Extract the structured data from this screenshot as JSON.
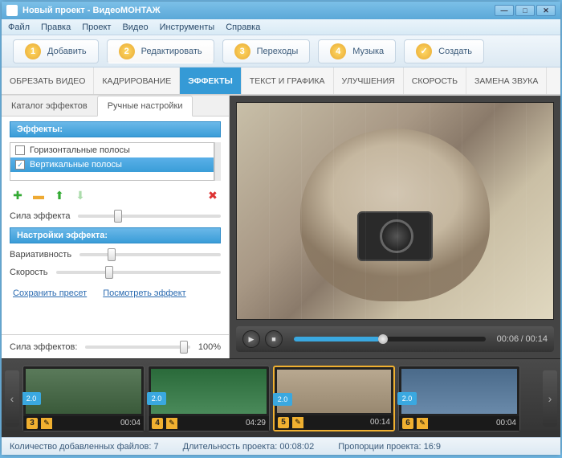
{
  "window": {
    "title": "Новый проект - ВидеоМОНТАЖ"
  },
  "menu": {
    "items": [
      "Файл",
      "Правка",
      "Проект",
      "Видео",
      "Инструменты",
      "Справка"
    ]
  },
  "mainTabs": [
    {
      "num": "1",
      "label": "Добавить"
    },
    {
      "num": "2",
      "label": "Редактировать",
      "active": true
    },
    {
      "num": "3",
      "label": "Переходы"
    },
    {
      "num": "4",
      "label": "Музыка"
    },
    {
      "num": "✓",
      "label": "Создать",
      "check": true
    }
  ],
  "subTabs": [
    "ОБРЕЗАТЬ ВИДЕО",
    "КАДРИРОВАНИЕ",
    "ЭФФЕКТЫ",
    "ТЕКСТ И ГРАФИКА",
    "УЛУЧШЕНИЯ",
    "СКОРОСТЬ",
    "ЗАМЕНА ЗВУКА"
  ],
  "subTabActive": 2,
  "leftPanel": {
    "tabs": [
      "Каталог эффектов",
      "Ручные настройки"
    ],
    "tabActive": 1,
    "effectsHeader": "Эффекты:",
    "effects": [
      {
        "label": "Горизонтальные полосы",
        "checked": false,
        "selected": false
      },
      {
        "label": "Вертикальные полосы",
        "checked": true,
        "selected": true
      }
    ],
    "strengthLabel": "Сила эффекта",
    "settingsHeader": "Настройки эффекта:",
    "variabilityLabel": "Вариативность",
    "speedLabel": "Скорость",
    "savePreset": "Сохранить пресет",
    "viewEffect": "Посмотреть эффект",
    "overallLabel": "Сила эффектов:",
    "overallValue": "100%"
  },
  "player": {
    "current": "00:06",
    "total": "00:14"
  },
  "timeline": {
    "clips": [
      {
        "num": "3",
        "dur": "00:04",
        "trans": "2.0"
      },
      {
        "num": "4",
        "dur": "04:29",
        "trans": "2.0"
      },
      {
        "num": "5",
        "dur": "00:14",
        "trans": "2.0",
        "selected": true,
        "starred": true
      },
      {
        "num": "6",
        "dur": "00:04",
        "trans": "2.0"
      }
    ]
  },
  "status": {
    "filesLabel": "Количество добавленных файлов:",
    "filesVal": "7",
    "durLabel": "Длительность проекта:",
    "durVal": "00:08:02",
    "propLabel": "Пропорции проекта:",
    "propVal": "16:9"
  }
}
